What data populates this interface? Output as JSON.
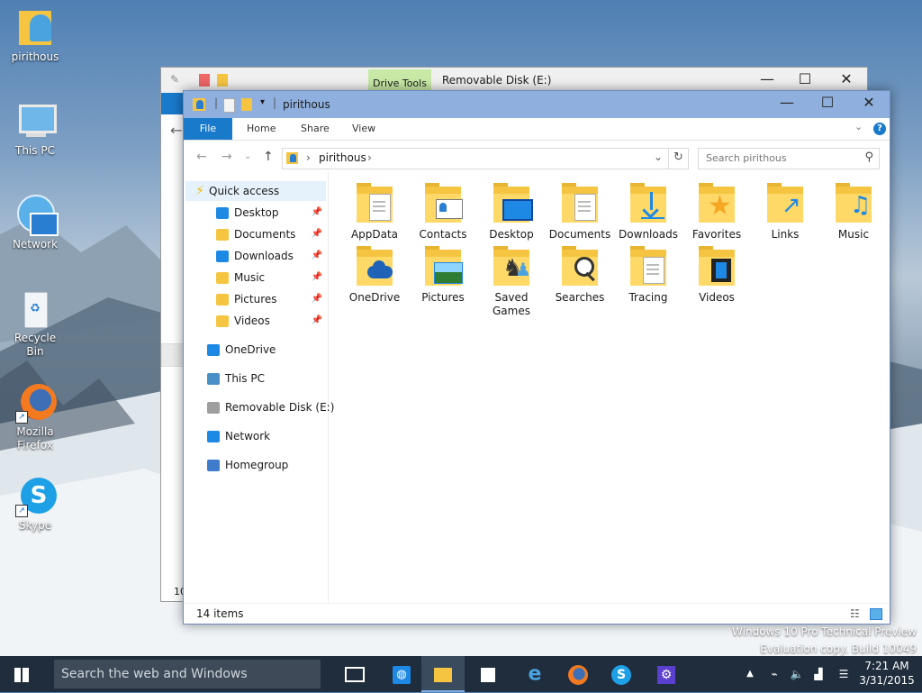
{
  "desktop_icons": [
    {
      "label": "pirithous",
      "name": "desktop-icon-pirithous"
    },
    {
      "label": "This PC",
      "name": "desktop-icon-this-pc"
    },
    {
      "label": "Network",
      "name": "desktop-icon-network"
    },
    {
      "label": "Recycle Bin",
      "name": "desktop-icon-recycle-bin"
    },
    {
      "label_line1": "Mozilla",
      "label_line2": "Firefox",
      "name": "desktop-icon-firefox"
    },
    {
      "label": "Skype",
      "name": "desktop-icon-skype"
    }
  ],
  "back_window": {
    "contextual_tab": "Drive Tools",
    "title": "Removable Disk (E:)",
    "status_fragment": "10"
  },
  "window": {
    "title": "pirithous",
    "ribbon_tabs": [
      "File",
      "Home",
      "Share",
      "View"
    ],
    "address_path": "pirithous",
    "search_placeholder": "Search pirithous",
    "status": "14 items"
  },
  "nav_pane": {
    "quick_access": "Quick access",
    "pinned": [
      {
        "label": "Desktop",
        "color": "#1e88e5"
      },
      {
        "label": "Documents",
        "color": "#f5c542"
      },
      {
        "label": "Downloads",
        "color": "#1e88e5"
      },
      {
        "label": "Music",
        "color": "#f5c542"
      },
      {
        "label": "Pictures",
        "color": "#f5c542"
      },
      {
        "label": "Videos",
        "color": "#f5c542"
      }
    ],
    "locations": [
      {
        "label": "OneDrive",
        "color": "#1e88e5"
      },
      {
        "label": "This PC",
        "color": "#4a90c8"
      },
      {
        "label": "Removable Disk (E:)",
        "color": "#9e9e9e"
      },
      {
        "label": "Network",
        "color": "#1e88e5"
      },
      {
        "label": "Homegroup",
        "color": "#3f7ccc"
      }
    ]
  },
  "folders": [
    {
      "label": "AppData",
      "icon": "document-icon"
    },
    {
      "label": "Contacts",
      "icon": "contact-card-icon"
    },
    {
      "label": "Desktop",
      "icon": "monitor-icon"
    },
    {
      "label": "Documents",
      "icon": "document-icon"
    },
    {
      "label": "Downloads",
      "icon": "download-arrow-icon"
    },
    {
      "label": "Favorites",
      "icon": "star-icon"
    },
    {
      "label": "Links",
      "icon": "link-arrow-icon"
    },
    {
      "label": "Music",
      "icon": "music-note-icon"
    },
    {
      "label": "OneDrive",
      "icon": "cloud-icon"
    },
    {
      "label": "Pictures",
      "icon": "landscape-icon"
    },
    {
      "label_line1": "Saved",
      "label_line2": "Games",
      "icon": "chess-pieces-icon"
    },
    {
      "label": "Searches",
      "icon": "magnifier-icon"
    },
    {
      "label": "Tracing",
      "icon": "document-icon"
    },
    {
      "label": "Videos",
      "icon": "film-strip-icon"
    }
  ],
  "watermark": {
    "line1": "Windows 10 Pro Technical Preview",
    "line2": "Evaluation copy. Build 10049"
  },
  "taskbar": {
    "search_placeholder": "Search the web and Windows",
    "time": "7:21 AM",
    "date": "3/31/2015"
  },
  "colors": {
    "accent": "#1979ca",
    "title_bar": "#8fb0de",
    "folder_yellow": "#ffd968",
    "taskbar": "#1f2d3d"
  }
}
